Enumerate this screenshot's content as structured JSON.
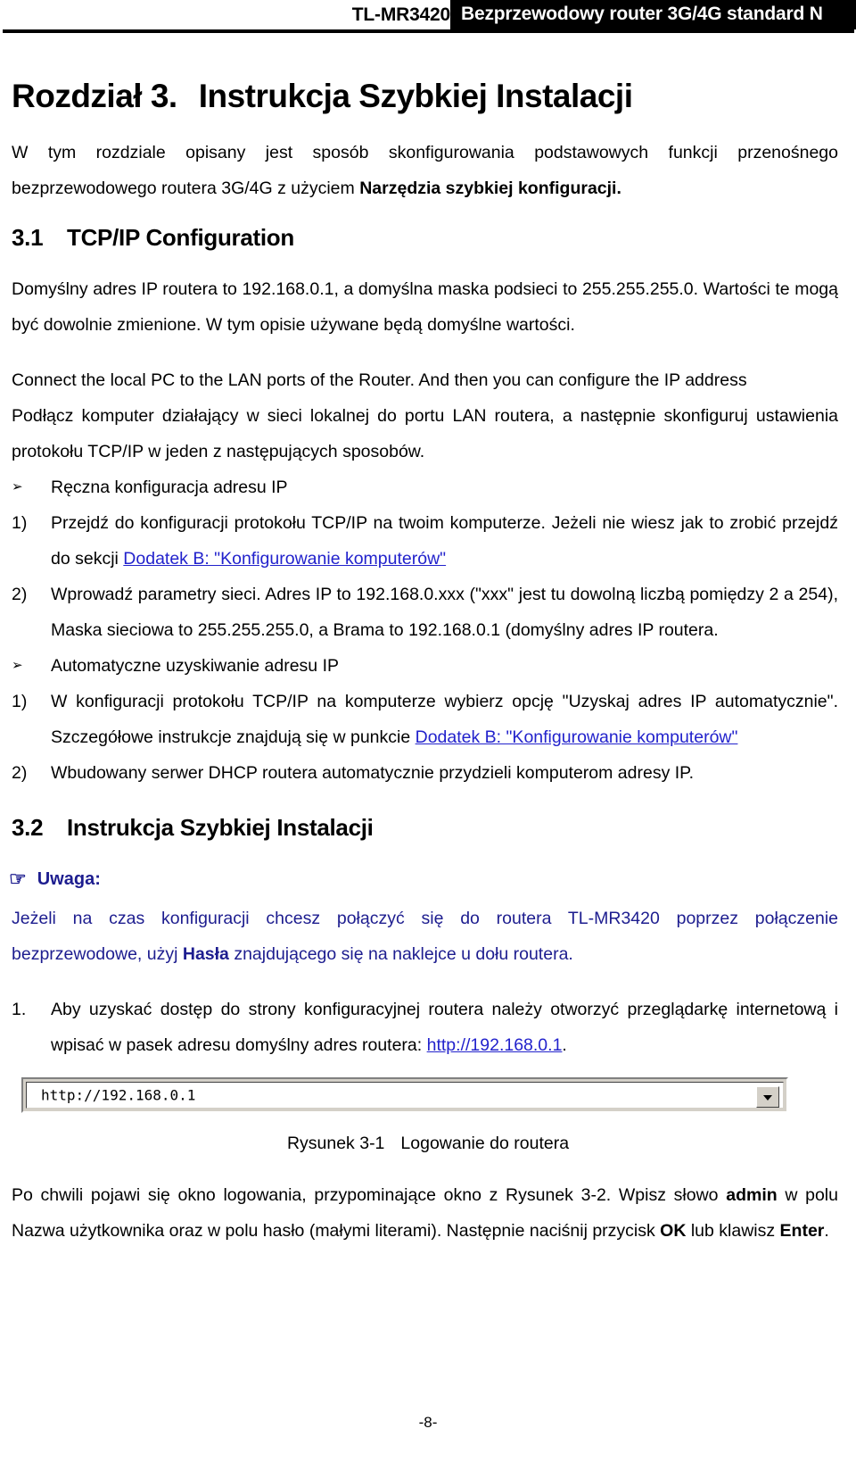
{
  "header": {
    "model": "TL-MR3420",
    "product_line": "Bezprzewodowy router 3G/4G standard N"
  },
  "chapter": {
    "number": "Rozdział 3.",
    "title": "Instrukcja Szybkiej Instalacji"
  },
  "intro": {
    "line1": "W tym rozdziale opisany jest sposób skonfigurowania podstawowych funkcji przenośnego bezprzewodowego routera 3G/4G z użyciem ",
    "bold": "Narzędzia szybkiej konfiguracji.",
    "after": ""
  },
  "section31": {
    "number": "3.1",
    "title": "TCP/IP Configuration",
    "para1": "Domyślny adres IP routera to 192.168.0.1, a domyślna maska podsieci to 255.255.255.0. Wartości te mogą być dowolnie zmienione. W tym opisie używane będą domyślne wartości.",
    "para2_en": "Connect the local PC to the LAN ports of the Router. And then you can configure the IP address",
    "para2_pl": "Podłącz komputer działający w sieci lokalnej do portu LAN routera, a następnie skonfiguruj ustawienia protokołu TCP/IP w jeden z następujących sposobów."
  },
  "manual_list": {
    "bullet_marker": "➢",
    "bullet_label": "Ręczna konfiguracja adresu IP",
    "items": [
      {
        "marker": "1)",
        "text_before": "Przejdź do konfiguracji protokołu TCP/IP na twoim komputerze. Jeżeli nie wiesz jak to zrobić przejdź do sekcji ",
        "link": "Dodatek B: \"Konfigurowanie komputerów\"",
        "text_after": ""
      },
      {
        "marker": "2)",
        "text_before": "Wprowadź parametry sieci. Adres IP to 192.168.0.xxx (\"xxx\" jest tu dowolną liczbą pomiędzy 2 a 254), Maska sieciowa to 255.255.255.0, a Brama to 192.168.0.1 (domyślny adres IP routera.",
        "link": "",
        "text_after": ""
      }
    ]
  },
  "auto_list": {
    "bullet_marker": "➢",
    "bullet_label": "Automatyczne uzyskiwanie adresu IP",
    "items": [
      {
        "marker": "1)",
        "text_before": "W konfiguracji protokołu TCP/IP na komputerze wybierz opcję \"Uzyskaj adres IP automatycznie\". Szczegółowe instrukcje znajdują się w punkcie ",
        "link": "Dodatek B: \"Konfigurowanie komputerów\"",
        "text_after": ""
      },
      {
        "marker": "2)",
        "text_before": "Wbudowany serwer DHCP routera automatycznie przydzieli komputerom adresy IP.",
        "link": "",
        "text_after": ""
      }
    ]
  },
  "section32": {
    "number": "3.2",
    "title": "Instrukcja Szybkiej Instalacji"
  },
  "note": {
    "icon": "☞",
    "heading": "Uwaga:",
    "text_before": "Jeżeli na czas konfiguracji chcesz połączyć się do routera TL-MR3420 poprzez połączenie bezprzewodowe, użyj ",
    "bold": "Hasła",
    "text_after": " znajdującego się na naklejce u dołu routera."
  },
  "step1": {
    "marker": "1.",
    "text_before": "Aby uzyskać dostęp do strony konfiguracyjnej routera należy otworzyć przeglądarkę internetową i wpisać w pasek adresu domyślny adres routera: ",
    "link": "http://192.168.0.1",
    "text_after": "."
  },
  "address_bar": {
    "value": "http://192.168.0.1",
    "dropdown_icon": "chevron-down-icon"
  },
  "figure": {
    "number": "Rysunek 3-1",
    "caption": "Logowanie do routera"
  },
  "closing": {
    "part1": "Po chwili pojawi się okno logowania, przypominające okno z Rysunek 3-2. Wpisz słowo ",
    "bold1": "admin",
    "part2": " w polu Nazwa użytkownika oraz w polu hasło (małymi literami). Następnie naciśnij przycisk ",
    "bold2": "OK",
    "part3": " lub klawisz ",
    "bold3": "Enter",
    "part4": "."
  },
  "footer": {
    "page_number": "-8-"
  },
  "colors": {
    "link": "#2222cc",
    "note_text": "#1d1d8f",
    "header_band": "#000000"
  }
}
